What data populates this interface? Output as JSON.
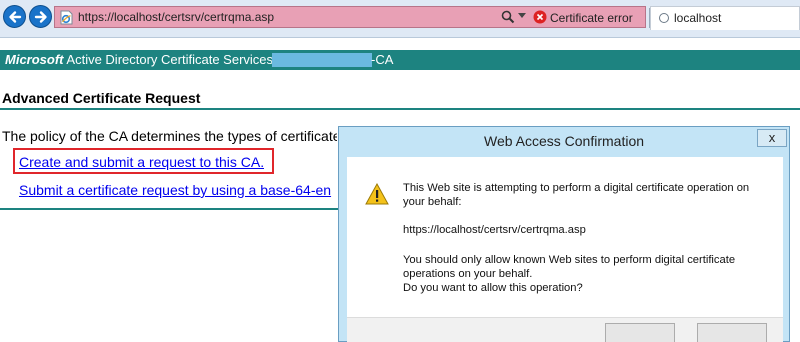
{
  "browser": {
    "address": "https://localhost/certsrv/certrqma.asp",
    "cert_error": "Certificate error",
    "tab_title": "localhost"
  },
  "page": {
    "banner_brand": "Microsoft",
    "banner_title": "Active Directory Certificate Services –",
    "ca_suffix": "-CA",
    "heading": "Advanced Certificate Request",
    "intro": "The policy of the CA determines the types of certificate",
    "links": {
      "create": "Create and submit a request to this CA.",
      "base64": "Submit a certificate request by using a base-64-en"
    }
  },
  "dialog": {
    "title": "Web Access Confirmation",
    "close": "x",
    "line1": "This Web site is attempting to perform a digital certificate operation on",
    "line2": "your behalf:",
    "url": "https://localhost/certsrv/certrqma.asp",
    "line3": "You should only allow known Web sites to perform digital certificate",
    "line4": "operations on your behalf.",
    "question": "Do you want to allow this operation?"
  },
  "colors": {
    "banner": "#1d8380",
    "address_error": "#e8a0b5",
    "highlight": "#e0262b",
    "link": "#0000ee"
  }
}
